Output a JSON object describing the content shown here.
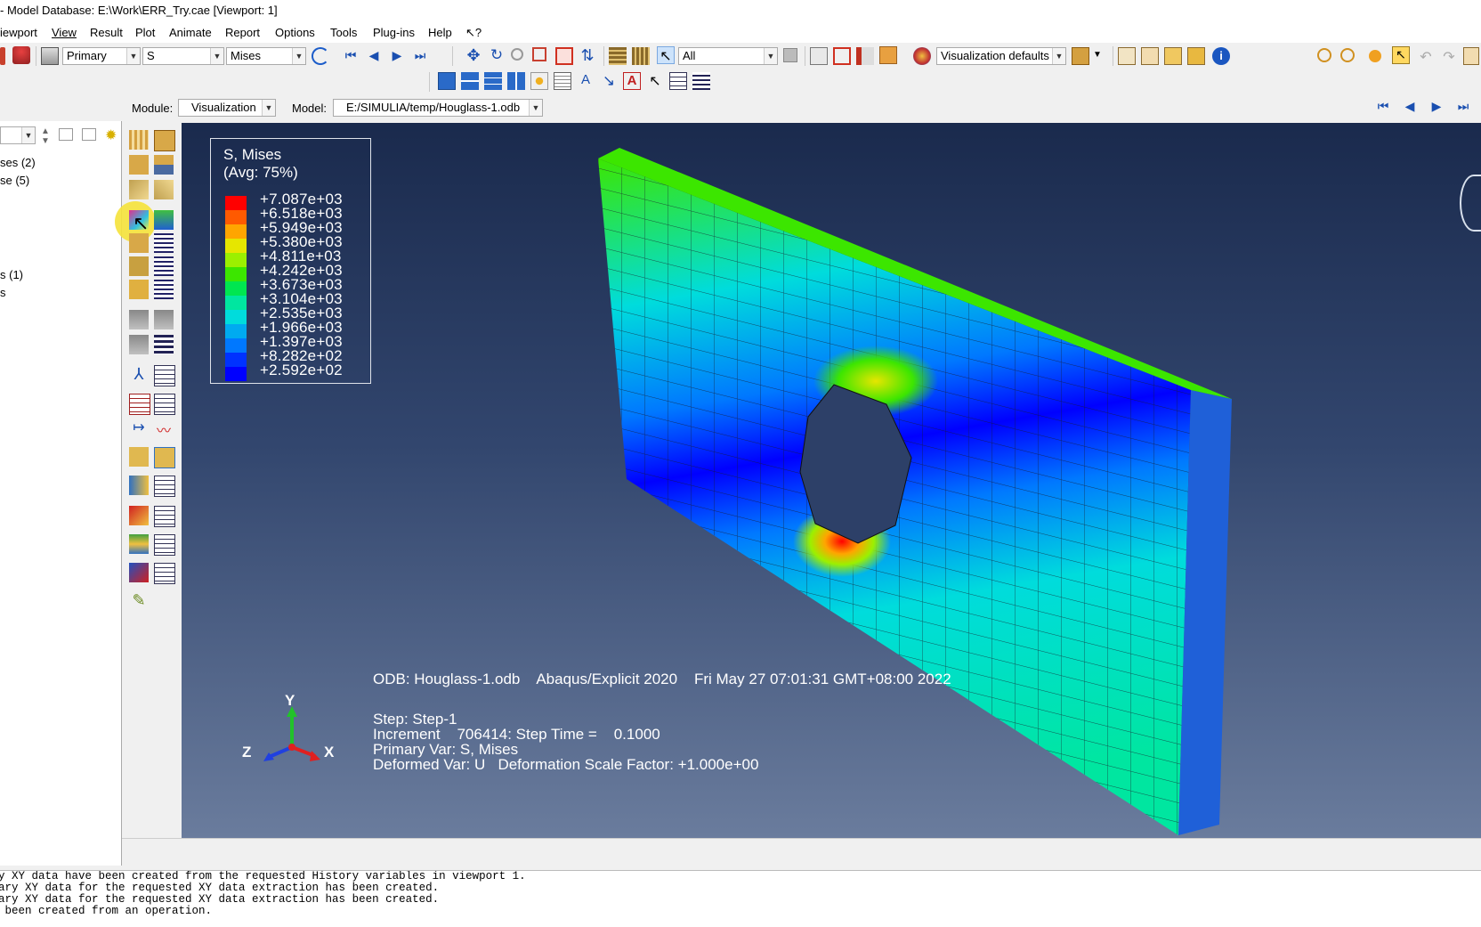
{
  "title_bar": {
    "text": "- Model Database: E:\\Work\\ERR_Try.cae [Viewport: 1]"
  },
  "menu": [
    "iewport",
    "View",
    "Result",
    "Plot",
    "Animate",
    "Report",
    "Options",
    "Tools",
    "Plug-ins",
    "Help",
    "↖?"
  ],
  "toolbar1": {
    "step_value": "Primary",
    "field_value": "S",
    "invariant_value": "Mises",
    "selection_filter": "All",
    "view_options": "Visualization defaults"
  },
  "context_bar": {
    "module_label": "Module:",
    "module_value": "Visualization",
    "model_label": "Model:",
    "model_value": "E:/SIMULIA/temp/Houglass-1.odb"
  },
  "tree": {
    "rows": [
      "ses (2)",
      "se (5)",
      "s (1)",
      "s"
    ]
  },
  "legend": {
    "title_line1": "S, Mises",
    "title_line2": "(Avg: 75%)",
    "values": [
      "+7.087e+03",
      "+6.518e+03",
      "+5.949e+03",
      "+5.380e+03",
      "+4.811e+03",
      "+4.242e+03",
      "+3.673e+03",
      "+3.104e+03",
      "+2.535e+03",
      "+1.966e+03",
      "+1.397e+03",
      "+8.282e+02",
      "+2.592e+02"
    ],
    "colors": [
      "#ff0000",
      "#ff5a00",
      "#ffa500",
      "#e6e600",
      "#9bf000",
      "#3ce600",
      "#00e650",
      "#00e6a0",
      "#00dcdc",
      "#00aaf0",
      "#0078ff",
      "#0032ff",
      "#0000ff"
    ]
  },
  "viewport_info": {
    "odb_line": "ODB: Houglass-1.odb    Abaqus/Explicit 2020    Fri May 27 07:01:31 GMT+08:00 2022",
    "step_line": "Step: Step-1",
    "increment_line": "Increment    706414: Step Time =    0.1000",
    "primary_var_line": "Primary Var: S, Mises",
    "deformed_var_line": "Deformed Var: U   Deformation Scale Factor: +1.000e+00"
  },
  "triad": {
    "y": "Y",
    "z": "Z",
    "x": "X",
    "colors": {
      "y": "#22c22a",
      "z": "#2040e0",
      "x": "#e02020"
    }
  },
  "messages": [
    "y XY data have been created from the requested History variables in viewport 1.",
    "ary XY data for the requested XY data extraction has been created.",
    "ary XY data for the requested XY data extraction has been created.",
    " been created from an operation."
  ],
  "icons": {
    "toolbar1": [
      "step-select-icon",
      "field-output-icon",
      "sync-icon",
      "first-frame-icon",
      "previous-frame-icon",
      "next-frame-icon",
      "last-frame-icon",
      "pan-icon",
      "rotate-icon",
      "zoom-icon",
      "box-zoom-icon",
      "auto-fit-icon",
      "cycle-views-icon",
      "ruler-icon",
      "ruler2-icon",
      "select-icon",
      "toggle-icon",
      "replace-icon",
      "box-select-icon",
      "display-group-icon",
      "palette-icon",
      "view-cube-icon",
      "iso-view-icon",
      "front-view-icon",
      "right-view-icon",
      "info-icon"
    ],
    "toolbar2": [
      "viewport-icon",
      "tile-icon",
      "cascade-icon",
      "query-icon",
      "text-icon",
      "arrow-icon",
      "annotation-text-icon",
      "cursor-icon",
      "table-icon",
      "list-icon"
    ],
    "toolbox": [
      "plot-undeformed-icon",
      "plot-deformed-icon",
      "plot-contours-icon",
      "plot-symbols-icon",
      "animate-icon",
      "xy-plot-icon",
      "report-icon",
      "tools-icon"
    ],
    "animation": [
      "anim-first-icon",
      "anim-prev-icon",
      "anim-play-icon",
      "anim-last-icon"
    ]
  }
}
